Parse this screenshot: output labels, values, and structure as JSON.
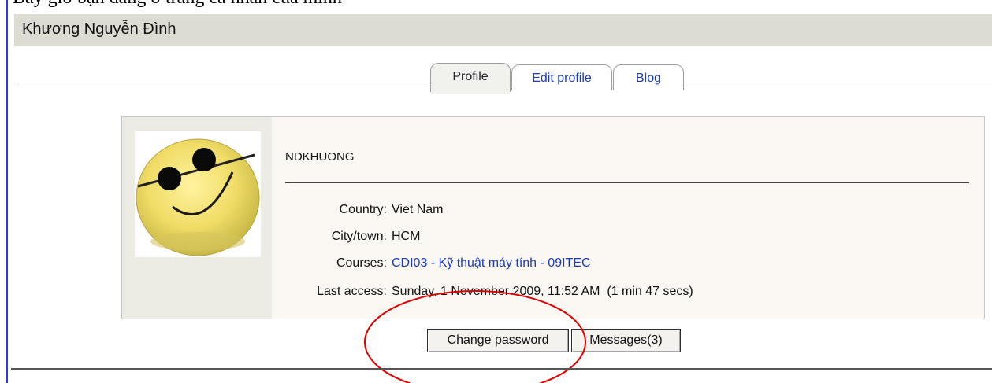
{
  "top_text": "Bây giờ bạn đang ở trang cá nhân của mình",
  "header": {
    "title": "Khương Nguyễn Đình"
  },
  "tabs": [
    {
      "label": "Profile",
      "active": true
    },
    {
      "label": "Edit profile",
      "active": false
    },
    {
      "label": "Blog",
      "active": false
    }
  ],
  "profile": {
    "username": "NDKHUONG",
    "avatar_icon": "smiley-sunglasses-icon",
    "fields": {
      "country": {
        "label": "Country:",
        "value": "Viet Nam"
      },
      "city": {
        "label": "City/town:",
        "value": "HCM"
      },
      "courses": {
        "label": "Courses:",
        "value": "CDI03 - Kỹ thuật máy tính - 09ITEC"
      },
      "last_access": {
        "label": "Last access:",
        "value": "Sunday, 1 November 2009, 11:52 AM  (1 min 47 secs)"
      }
    }
  },
  "buttons": {
    "change_password": "Change password",
    "messages": "Messages(3)"
  },
  "colors": {
    "link": "#1a3bb5",
    "annotation": "#e00000",
    "left_bar": "#2f3bd6"
  }
}
